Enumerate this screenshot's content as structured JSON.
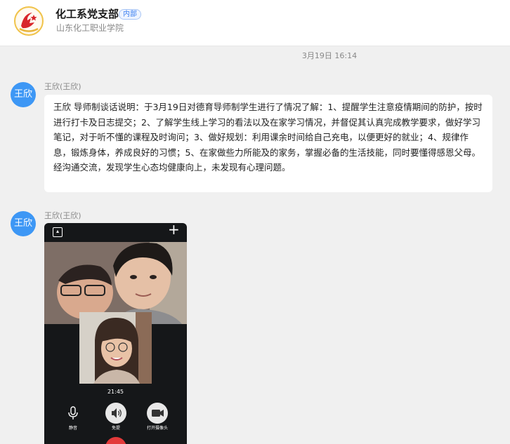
{
  "header": {
    "title": "化工系党支部",
    "badge": "内部",
    "subtitle": "山东化工职业学院",
    "logo_icon": "party-emblem-icon"
  },
  "timestamp": "3月19日 16:14",
  "messages": [
    {
      "avatar_text": "王欣",
      "sender": "王欣(王欣)",
      "text": "王欣 导师制谈话说明：于3月19日对德育导师制学生进行了情况了解：1、提醒学生注意疫情期间的防护，按时进行打卡及日志提交；2、了解学生线上学习的看法以及在家学习情况，并督促其认真完成教学要求，做好学习笔记，对于听不懂的课程及时询问；3、做好规划：利用课余时间给自己充电，以便更好的就业；4、规律作息，锻炼身体，养成良好的习惯；5、在家做些力所能及的家务，掌握必备的生活技能，同时要懂得感恩父母。\n经沟通交流，发现学生心态均健康向上，未发现有心理问题。"
    },
    {
      "avatar_text": "王欣",
      "sender": "王欣(王欣)",
      "video_call": {
        "time": "21:45",
        "controls": [
          {
            "label": "静音",
            "icon": "microphone-icon"
          },
          {
            "label": "免提",
            "icon": "speaker-icon"
          },
          {
            "label": "打开摄像头",
            "icon": "camera-icon"
          }
        ],
        "hangup_icon": "hangup-icon"
      }
    }
  ],
  "colors": {
    "avatar": "#3d97f5",
    "badge": "#3b7ff0",
    "page_bg": "#f0f0f0"
  }
}
